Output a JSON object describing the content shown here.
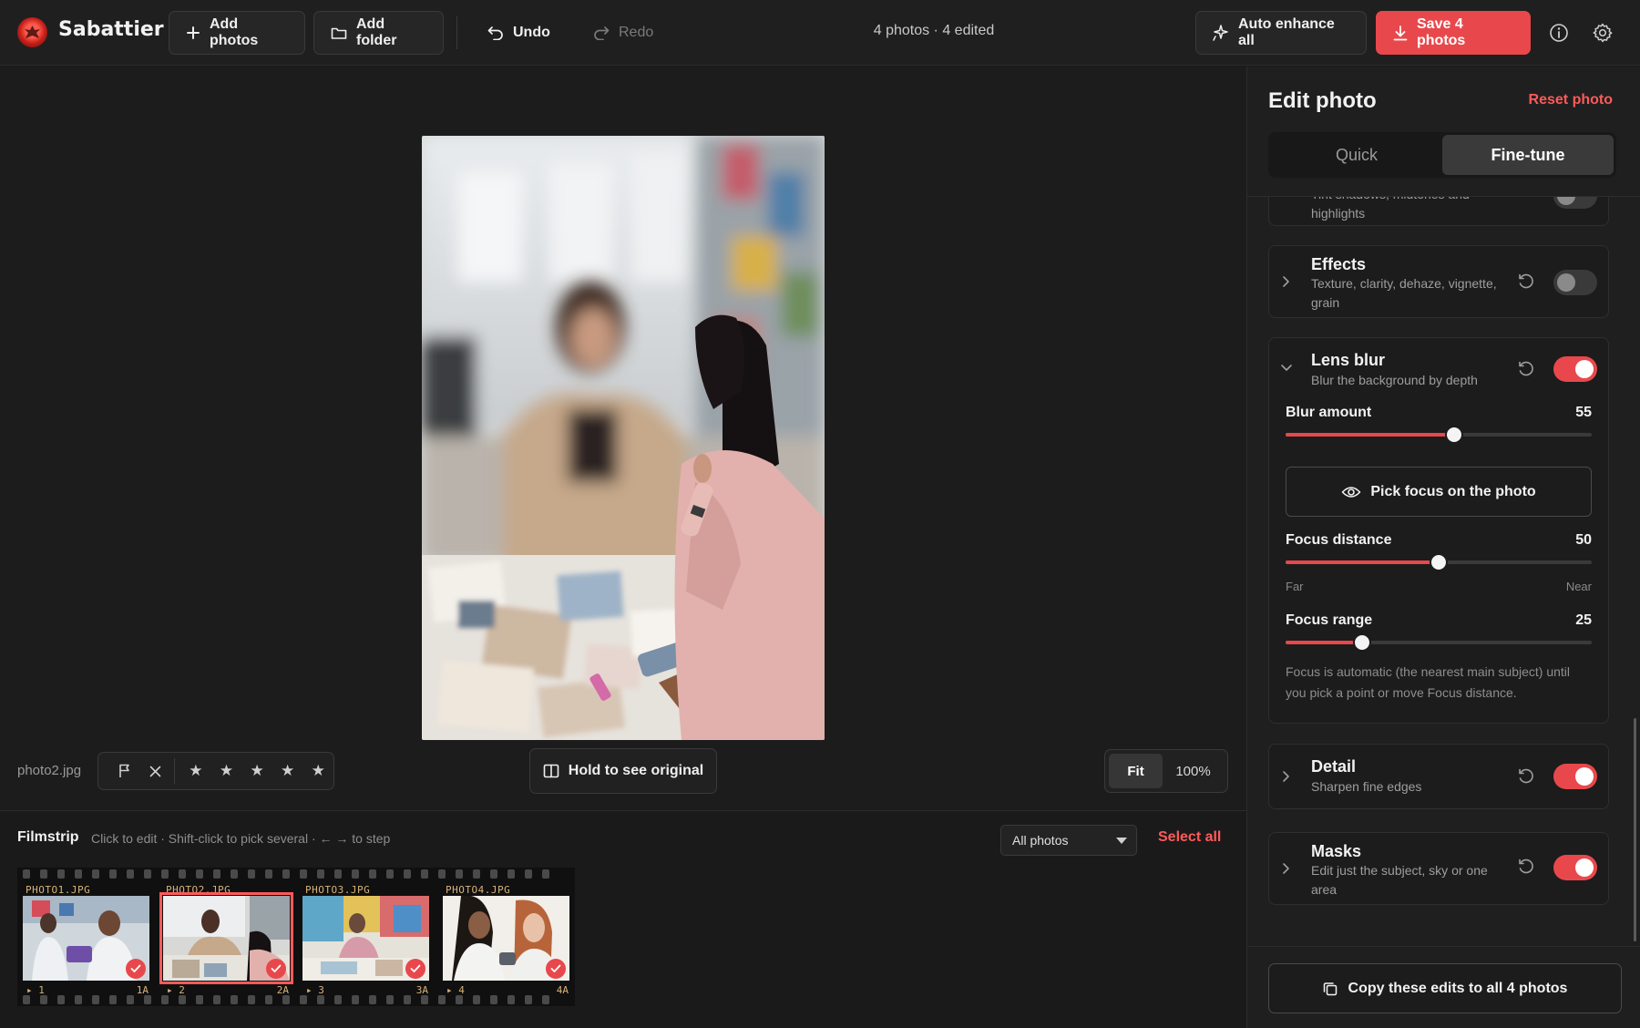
{
  "app": {
    "name": "Sabattier"
  },
  "toolbar": {
    "add_photos": "Add photos",
    "add_folder": "Add folder",
    "undo": "Undo",
    "redo": "Redo",
    "status": "4 photos · 4 edited",
    "auto_enhance": "Auto enhance all",
    "save": "Save 4 photos"
  },
  "viewer": {
    "filename": "photo2.jpg",
    "hold_original": "Hold to see original",
    "zoom_fit": "Fit",
    "zoom_100": "100%",
    "stars": [
      "★",
      "★",
      "★",
      "★",
      "★"
    ]
  },
  "filmstrip": {
    "title": "Filmstrip",
    "hint": "Click to edit · Shift-click to pick several · ← → to step",
    "filter_selected": "All photos",
    "select_all": "Select all",
    "frames": [
      {
        "label": "PHOTO1.JPG",
        "num": "▸ 1",
        "numr": "1A",
        "edited": true,
        "selected": false
      },
      {
        "label": "PHOTO2.JPG",
        "num": "▸ 2",
        "numr": "2A",
        "edited": true,
        "selected": true
      },
      {
        "label": "PHOTO3.JPG",
        "num": "▸ 3",
        "numr": "3A",
        "edited": true,
        "selected": false
      },
      {
        "label": "PHOTO4.JPG",
        "num": "▸ 4",
        "numr": "4A",
        "edited": true,
        "selected": false
      }
    ]
  },
  "panel": {
    "title": "Edit photo",
    "reset": "Reset photo",
    "tabs": [
      "Quick",
      "Fine-tune"
    ],
    "active_tab": "Fine-tune",
    "partial_card_sub": "Tint shadows, midtones and highlights",
    "effects": {
      "title": "Effects",
      "sub": "Texture, clarity, dehaze, vignette, grain",
      "enabled": false
    },
    "lens_blur": {
      "title": "Lens blur",
      "sub": "Blur the background by depth",
      "enabled": true,
      "blur_amount": {
        "label": "Blur amount",
        "value": "55",
        "fraction": 0.55
      },
      "pick_focus": "Pick focus on the photo",
      "focus_distance": {
        "label": "Focus distance",
        "value": "50",
        "fraction": 0.5,
        "min_label": "Far",
        "max_label": "Near"
      },
      "focus_range": {
        "label": "Focus range",
        "value": "25",
        "fraction": 0.25
      },
      "note": "Focus is automatic (the nearest main subject) until you pick a point or move Focus distance."
    },
    "detail": {
      "title": "Detail",
      "sub": "Sharpen fine edges",
      "enabled": true
    },
    "masks": {
      "title": "Masks",
      "sub": "Edit just the subject, sky or one area",
      "enabled": true
    },
    "copy_edits": "Copy these edits to all 4 photos"
  },
  "colors": {
    "accent": "#e8484c",
    "accent_text": "#ff5a5a",
    "bg": "#1a1a1a"
  }
}
